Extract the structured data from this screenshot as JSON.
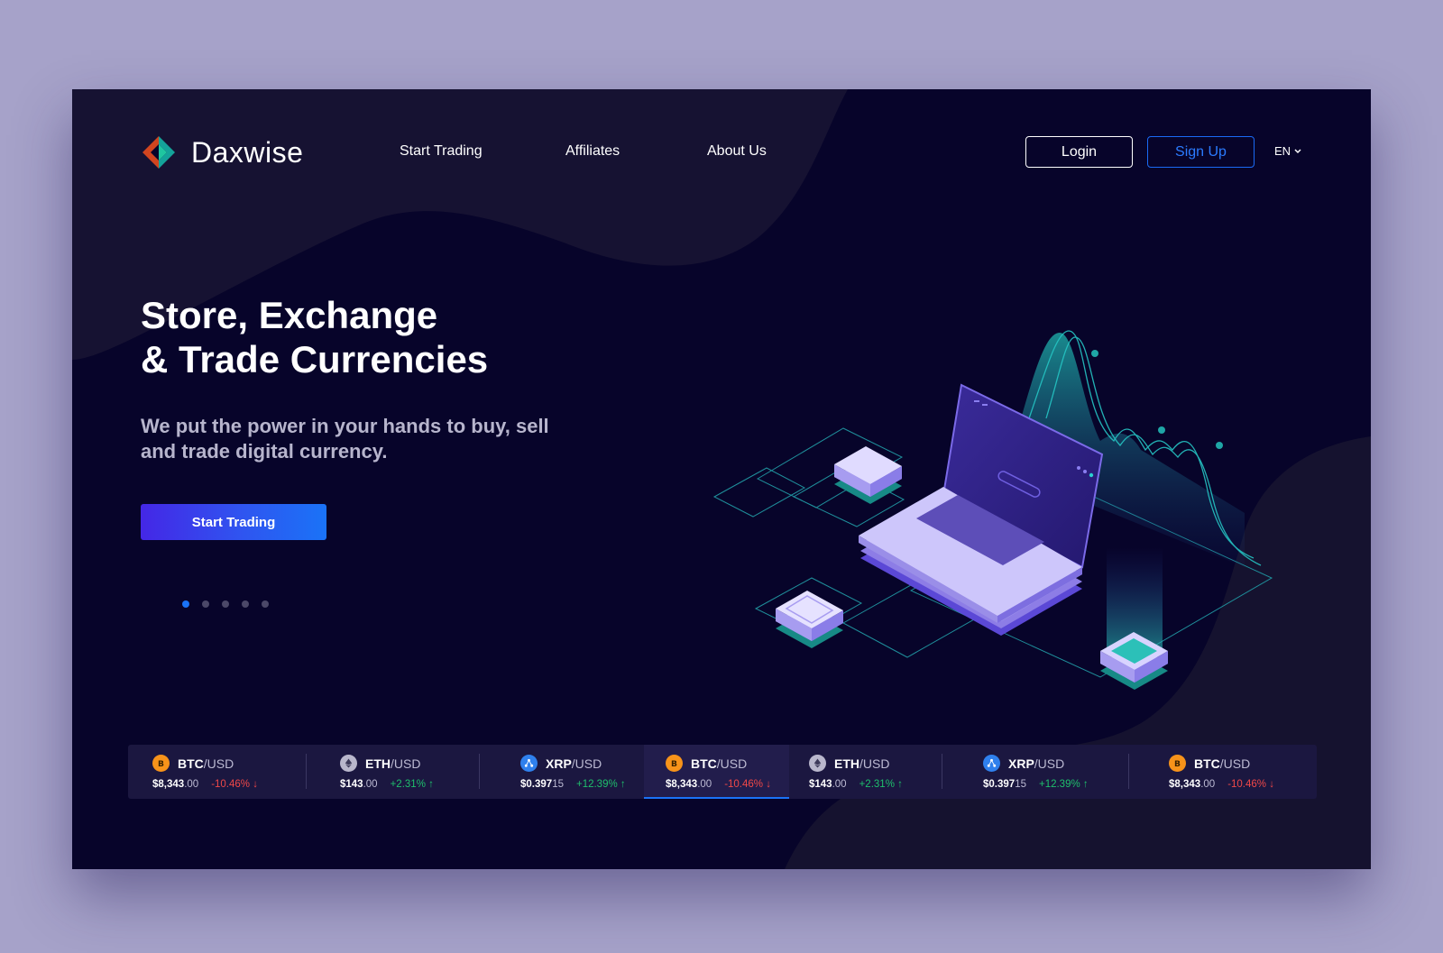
{
  "brand": {
    "name": "Daxwise"
  },
  "nav": [
    {
      "label": "Start Trading"
    },
    {
      "label": "Affiliates"
    },
    {
      "label": "About Us"
    }
  ],
  "auth": {
    "login_label": "Login",
    "signup_label": "Sign Up"
  },
  "language": {
    "value": "EN"
  },
  "hero": {
    "title_line1": "Store, Exchange",
    "title_line2": "& Trade Currencies",
    "subtitle": "We put the power in your hands to buy, sell and trade digital currency.",
    "cta_label": "Start Trading"
  },
  "carousel": {
    "count": 5,
    "active_index": 0
  },
  "colors": {
    "brand_blue": "#1a73f7",
    "btc": "#f7931a",
    "eth": "#b9b7cc",
    "xrp": "#2f80ed",
    "negative": "#f04848",
    "positive": "#1fbf6c"
  },
  "ticker": [
    {
      "icon": "btc-icon",
      "base": "BTC",
      "quote": "/USD",
      "price_main": "$8,343",
      "price_decimal": ".00",
      "change": "-10.46%",
      "direction": "down",
      "arrow": "↓",
      "active": false
    },
    {
      "icon": "eth-icon",
      "base": "ETH",
      "quote": "/USD",
      "price_main": "$143",
      "price_decimal": ".00",
      "change": "+2.31%",
      "direction": "up",
      "arrow": "↑",
      "active": false
    },
    {
      "icon": "xrp-icon",
      "base": "XRP",
      "quote": "/USD",
      "price_main": "$0.397",
      "price_decimal": "15",
      "change": "+12.39%",
      "direction": "up",
      "arrow": "↑",
      "active": false
    },
    {
      "icon": "btc-icon",
      "base": "BTC",
      "quote": "/USD",
      "price_main": "$8,343",
      "price_decimal": ".00",
      "change": "-10.46%",
      "direction": "down",
      "arrow": "↓",
      "active": true
    },
    {
      "icon": "eth-icon",
      "base": "ETH",
      "quote": "/USD",
      "price_main": "$143",
      "price_decimal": ".00",
      "change": "+2.31%",
      "direction": "up",
      "arrow": "↑",
      "active": false
    },
    {
      "icon": "xrp-icon",
      "base": "XRP",
      "quote": "/USD",
      "price_main": "$0.397",
      "price_decimal": "15",
      "change": "+12.39%",
      "direction": "up",
      "arrow": "↑",
      "active": false
    },
    {
      "icon": "btc-icon",
      "base": "BTC",
      "quote": "/USD",
      "price_main": "$8,343",
      "price_decimal": ".00",
      "change": "-10.46%",
      "direction": "down",
      "arrow": "↓",
      "active": false
    }
  ]
}
